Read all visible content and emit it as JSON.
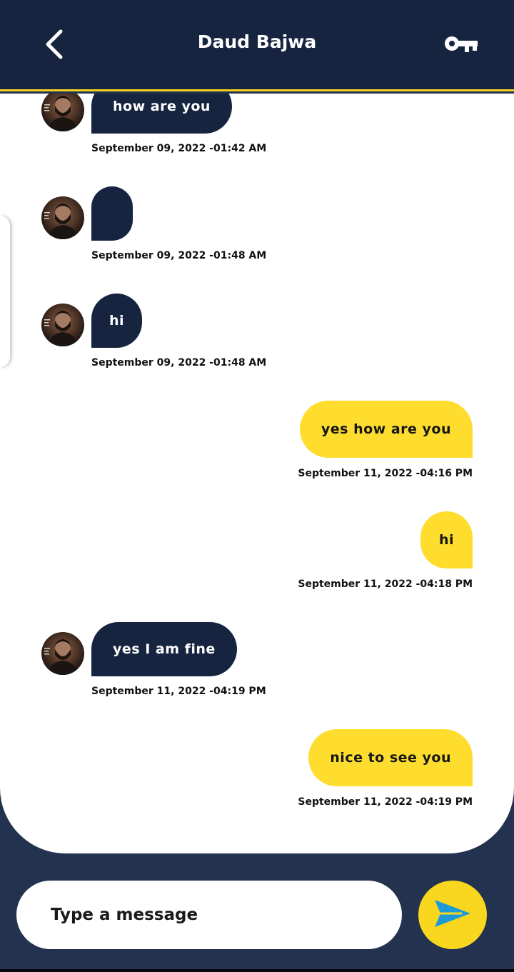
{
  "header": {
    "title": "Daud Bajwa",
    "back_icon": "chevron-left-icon",
    "action_icon": "key-icon",
    "background": "#162440",
    "accent": "#f5d21c"
  },
  "messages": [
    {
      "direction": "incoming",
      "text": "how are you",
      "timestamp": "September 09, 2022 -01:42 AM"
    },
    {
      "direction": "incoming",
      "text": "",
      "timestamp": "September 09, 2022 -01:48 AM"
    },
    {
      "direction": "incoming",
      "text": "hi",
      "timestamp": "September 09, 2022 -01:48 AM"
    },
    {
      "direction": "outgoing",
      "text": "yes how are you",
      "timestamp": "September 11, 2022 -04:16 PM"
    },
    {
      "direction": "outgoing",
      "text": "hi",
      "timestamp": "September 11, 2022 -04:18 PM"
    },
    {
      "direction": "incoming",
      "text": "yes I am fine",
      "timestamp": "September 11, 2022 -04:19 PM"
    },
    {
      "direction": "outgoing",
      "text": "nice to see you",
      "timestamp": "September 11, 2022 -04:19 PM"
    }
  ],
  "composer": {
    "placeholder": "Type a message",
    "send_icon": "send-icon"
  },
  "colors": {
    "incoming_bubble": "#162440",
    "outgoing_bubble": "#fedd2e",
    "composer_background": "#22324f",
    "send_button": "#f9d71f"
  }
}
